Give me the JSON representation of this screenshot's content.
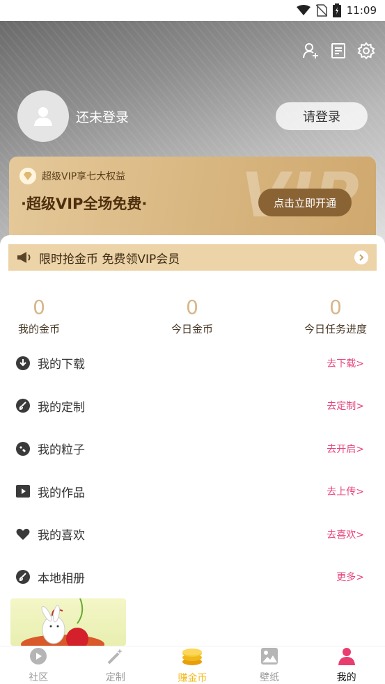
{
  "status_bar": {
    "time": "11:09",
    "icons": [
      "wifi-icon",
      "no-sim-icon",
      "battery-icon"
    ]
  },
  "header": {
    "icons": [
      "add-user-icon",
      "document-icon",
      "gear-icon"
    ],
    "login_status": "还未登录",
    "login_button": "请登录"
  },
  "vip": {
    "tag": "超级VIP享七大权益",
    "title": "·超级VIP全场免费·",
    "watermark": "VIP",
    "button": "点击立即开通"
  },
  "promo": {
    "text": "限时抢金币 免费领VIP会员"
  },
  "stats": [
    {
      "value": "0",
      "label": "我的金币"
    },
    {
      "value": "0",
      "label": "今日金币"
    },
    {
      "value": "0",
      "label": "今日任务进度"
    }
  ],
  "menu": [
    {
      "icon": "download-icon",
      "label": "我的下载",
      "action": "去下载>"
    },
    {
      "icon": "brush-icon",
      "label": "我的定制",
      "action": "去定制>"
    },
    {
      "icon": "particle-icon",
      "label": "我的粒子",
      "action": "去开启>"
    },
    {
      "icon": "play-icon",
      "label": "我的作品",
      "action": "去上传>"
    },
    {
      "icon": "heart-icon",
      "label": "我的喜欢",
      "action": "去喜欢>"
    },
    {
      "icon": "brush-icon",
      "label": "本地相册",
      "action": "更多>"
    }
  ],
  "bottom_nav": [
    {
      "icon": "community-icon",
      "label": "社区"
    },
    {
      "icon": "wand-icon",
      "label": "定制"
    },
    {
      "icon": "coins-icon",
      "label": "赚金币"
    },
    {
      "icon": "image-icon",
      "label": "壁纸"
    },
    {
      "icon": "person-icon",
      "label": "我的"
    }
  ],
  "colors": {
    "accent_pink": "#e8457b",
    "gold": "#d7b78a",
    "coin_yellow": "#f2b81a"
  }
}
